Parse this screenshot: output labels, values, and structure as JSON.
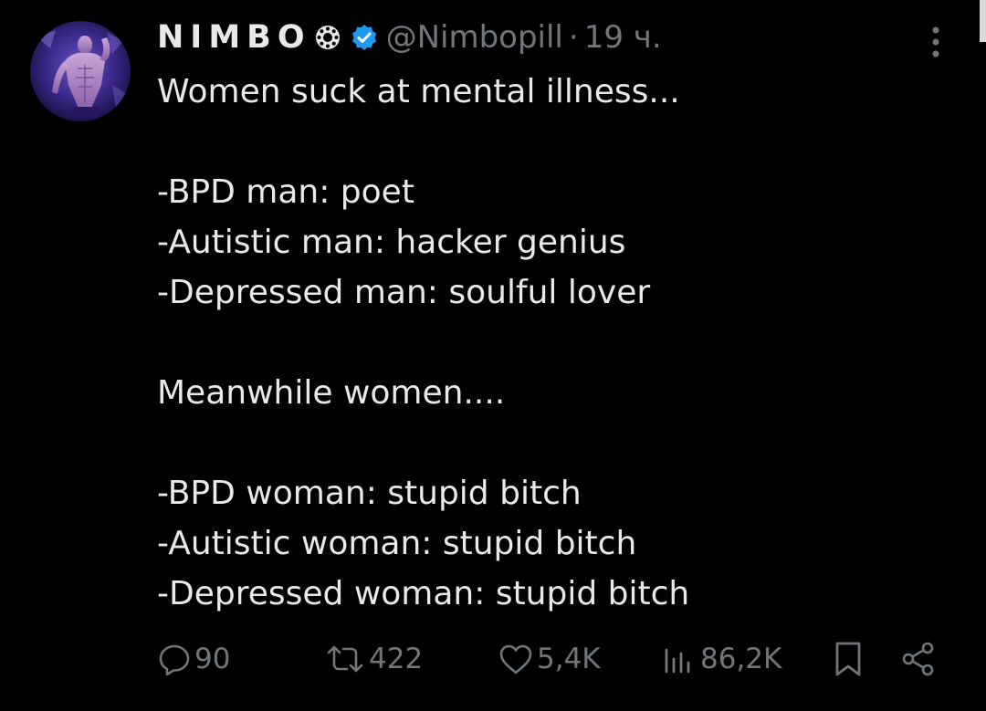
{
  "tweet": {
    "author": {
      "display_name": "NIMBO",
      "handle": "@Nimbopill",
      "verified": true,
      "avatar": "avatar-photo"
    },
    "separator": "·",
    "time": "19 ч.",
    "lines": [
      "Women suck at mental illness...",
      "",
      "-BPD man: poet",
      "-Autistic man: hacker genius",
      "-Depressed man: soulful lover",
      "",
      "Meanwhile women....",
      "",
      "-BPD woman: stupid bitch",
      "-Autistic woman: stupid bitch",
      "-Depressed woman: stupid bitch"
    ],
    "actions": {
      "reply": {
        "icon": "reply-icon",
        "count": "90"
      },
      "retweet": {
        "icon": "retweet-icon",
        "count": "422"
      },
      "like": {
        "icon": "like-icon",
        "count": "5,4K"
      },
      "views": {
        "icon": "views-icon",
        "count": "86,2K"
      },
      "bookmark": {
        "icon": "bookmark-icon"
      },
      "share": {
        "icon": "share-icon"
      }
    }
  },
  "colors": {
    "background": "#000000",
    "text": "#e7e9ea",
    "muted": "#71767b",
    "verified": "#1d9bf0"
  }
}
